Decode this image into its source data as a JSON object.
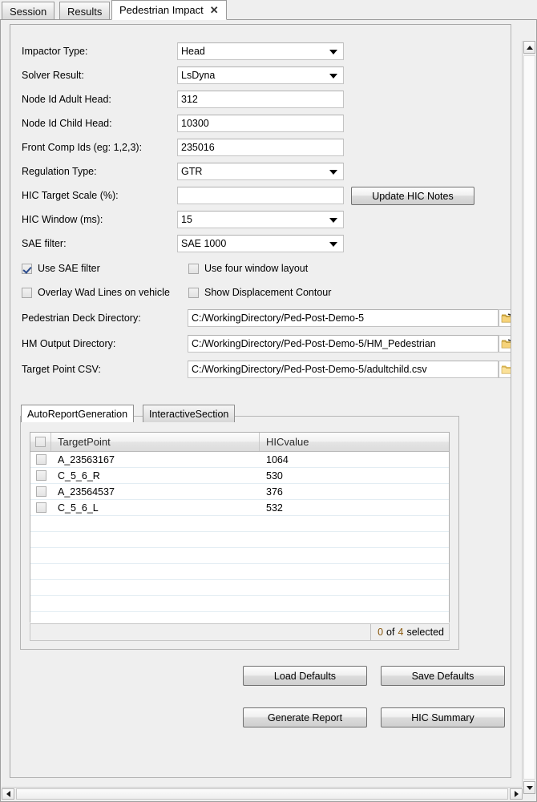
{
  "window_tabs": [
    {
      "label": "Session",
      "active": false,
      "closable": false
    },
    {
      "label": "Results",
      "active": false,
      "closable": false
    },
    {
      "label": "Pedestrian Impact",
      "active": true,
      "closable": true,
      "close_glyph": "✕"
    }
  ],
  "form": {
    "rows": [
      {
        "label": "Impactor Type:",
        "type": "combo",
        "value": "Head"
      },
      {
        "label": "Solver Result:",
        "type": "combo",
        "value": "LsDyna"
      },
      {
        "label": "Node Id Adult Head:",
        "type": "text",
        "value": "312"
      },
      {
        "label": "Node Id Child Head:",
        "type": "text",
        "value": "10300"
      },
      {
        "label": "Front Comp Ids (eg: 1,2,3):",
        "type": "text",
        "value": "235016"
      },
      {
        "label": "Regulation Type:",
        "type": "combo",
        "value": "GTR"
      },
      {
        "label": "HIC Target Scale (%):",
        "type": "text",
        "value": ""
      },
      {
        "label": "HIC Window (ms):",
        "type": "combo",
        "value": "15"
      },
      {
        "label": "SAE filter:",
        "type": "combo",
        "value": "SAE 1000"
      }
    ],
    "update_hic_notes_label": "Update HIC Notes"
  },
  "checkboxes": [
    {
      "label": "Use SAE filter",
      "checked": true
    },
    {
      "label": "Use four window layout",
      "checked": false
    },
    {
      "label": "Overlay Wad Lines on vehicle",
      "checked": false
    },
    {
      "label": "Show Displacement Contour",
      "checked": false
    }
  ],
  "paths": [
    {
      "label": "Pedestrian Deck Directory:",
      "value": "C:/WorkingDirectory/Ped-Post-Demo-5"
    },
    {
      "label": "HM Output Directory:",
      "value": "C:/WorkingDirectory/Ped-Post-Demo-5/HM_Pedestrian"
    },
    {
      "label": "Target Point CSV:",
      "value": "C:/WorkingDirectory/Ped-Post-Demo-5/adultchild.csv"
    }
  ],
  "inner_tabs": [
    {
      "label": "AutoReportGeneration",
      "active": true
    },
    {
      "label": "InteractiveSection",
      "active": false
    }
  ],
  "table": {
    "columns": [
      "TargetPoint",
      "HICvalue"
    ],
    "rows": [
      {
        "target_point": "A_23563167",
        "hic_value": "1064",
        "checked": false
      },
      {
        "target_point": "C_5_6_R",
        "hic_value": "530",
        "checked": false
      },
      {
        "target_point": "A_23564537",
        "hic_value": "376",
        "checked": false
      },
      {
        "target_point": "C_5_6_L",
        "hic_value": "532",
        "checked": false
      }
    ],
    "status": {
      "selected_count": "0",
      "of_word": "of",
      "total_count": "4",
      "suffix": "selected"
    }
  },
  "actions": [
    {
      "label": "Load Defaults"
    },
    {
      "label": "Save Defaults"
    },
    {
      "label": "Generate Report"
    },
    {
      "label": "HIC Summary"
    }
  ],
  "colors": {
    "background": "#efefef",
    "field_background": "#ffffff",
    "accent_number": "#8a5a10",
    "checkmark": "#2a4b8d",
    "folder_icon": "#f2c14e"
  }
}
